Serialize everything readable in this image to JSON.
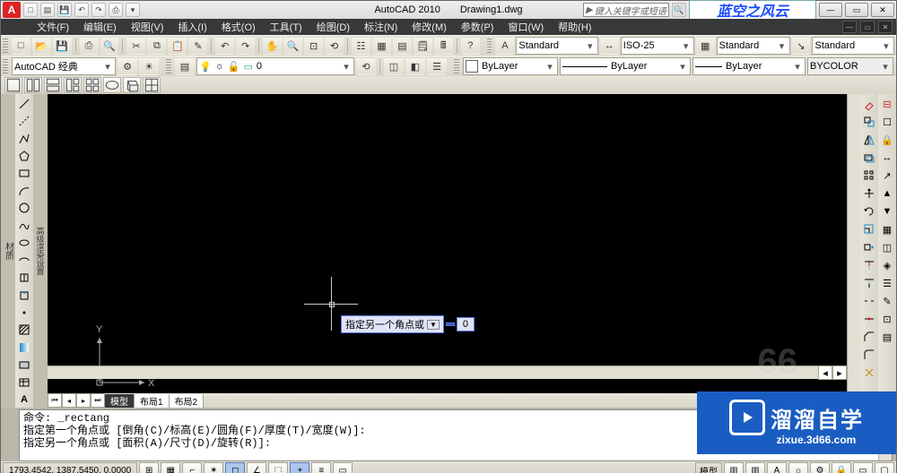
{
  "title": {
    "app": "AutoCAD 2010",
    "doc": "Drawing1.dwg",
    "search_placeholder": "键入关键字或短语"
  },
  "watermark1": "蓝空之风云",
  "watermark2": {
    "zh": "溜溜自学",
    "sub": "zixue.3d66.com"
  },
  "alpha_wm": "66",
  "menus": [
    "文件(F)",
    "编辑(E)",
    "视图(V)",
    "插入(I)",
    "格式(O)",
    "工具(T)",
    "绘图(D)",
    "标注(N)",
    "修改(M)",
    "参数(P)",
    "窗口(W)",
    "帮助(H)"
  ],
  "workspace": "AutoCAD 经典",
  "styles": {
    "text_style": "Standard",
    "dim_style": "ISO-25",
    "table_style": "Standard",
    "mleader_style": "Standard"
  },
  "layers": {
    "current": "0"
  },
  "props": {
    "color": "ByLayer",
    "linetype": "ByLayer",
    "lineweight": "ByLayer",
    "plotstyle": "BYCOLOR"
  },
  "dynamic_input": {
    "prompt": "指定另一个角点或",
    "val1": "",
    "val2": "0"
  },
  "ucs": {
    "x": "X",
    "y": "Y"
  },
  "model_tabs": {
    "model": "模型",
    "layout1": "布局1",
    "layout2": "布局2"
  },
  "cmd_lines": [
    "命令: _rectang",
    "指定第一个角点或 [倒角(C)/标高(E)/圆角(F)/厚度(T)/宽度(W)]:",
    "指定另一个角点或 [面积(A)/尺寸(D)/旋转(R)]:"
  ],
  "status": {
    "coords": "1793.4542, 1387.5450, 0.0000",
    "model": "模型"
  },
  "side_labels": {
    "left1": "材质",
    "left2": "高级渲染设置"
  }
}
